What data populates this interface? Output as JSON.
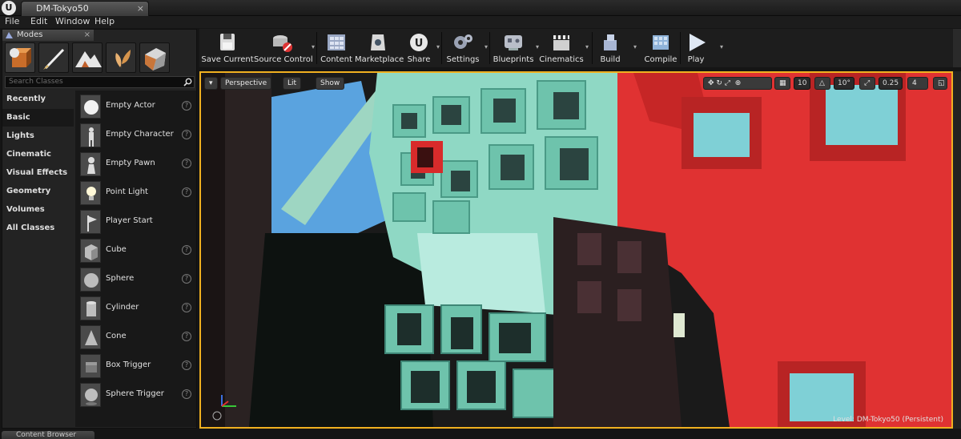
{
  "window": {
    "document_tab": "DM-Tokyo50",
    "close_glyph": "×"
  },
  "menu": [
    "File",
    "Edit",
    "Window",
    "Help"
  ],
  "modes_panel": {
    "tab_label": "Modes",
    "close_glyph": "×",
    "search_placeholder": "Search Classes",
    "categories": [
      "Recently Placed",
      "Basic",
      "Lights",
      "Cinematic",
      "Visual Effects",
      "Geometry",
      "Volumes",
      "All Classes"
    ],
    "active_category": "Basic",
    "items": [
      {
        "label": "Empty Actor",
        "icon": "sphere-white-icon"
      },
      {
        "label": "Empty Character",
        "icon": "character-icon"
      },
      {
        "label": "Empty Pawn",
        "icon": "pawn-icon"
      },
      {
        "label": "Point Light",
        "icon": "bulb-icon"
      },
      {
        "label": "Player Start",
        "icon": "flag-icon"
      },
      {
        "label": "Cube",
        "icon": "cube-icon"
      },
      {
        "label": "Sphere",
        "icon": "sphere-icon"
      },
      {
        "label": "Cylinder",
        "icon": "cylinder-icon"
      },
      {
        "label": "Cone",
        "icon": "cone-icon"
      },
      {
        "label": "Box Trigger",
        "icon": "box-trigger-icon"
      },
      {
        "label": "Sphere Trigger",
        "icon": "sphere-trigger-icon"
      }
    ],
    "help_glyph": "?"
  },
  "toolbar": {
    "save": "Save Current",
    "source_control": "Source Control",
    "content": "Content",
    "marketplace": "Marketplace",
    "share": "Share",
    "settings": "Settings",
    "blueprints": "Blueprints",
    "cinematics": "Cinematics",
    "build": "Build",
    "compile": "Compile",
    "play": "Play",
    "dropdown_glyph": "▾"
  },
  "viewport": {
    "perspective": "Perspective",
    "lit": "Lit",
    "show": "Show",
    "grid_snap": "10",
    "rotation_snap": "10°",
    "scale_snap": "0.25",
    "camera_speed": "4",
    "level_label": "Level:  DM-Tokyo50 (Persistent)"
  },
  "bottom": {
    "content_browser_tab": "Content Browser"
  },
  "colors": {
    "selection_outline": "#f0b020",
    "red_block": "#e03232",
    "teal_block": "#8fd8c4",
    "sky": "#5aa3df"
  }
}
